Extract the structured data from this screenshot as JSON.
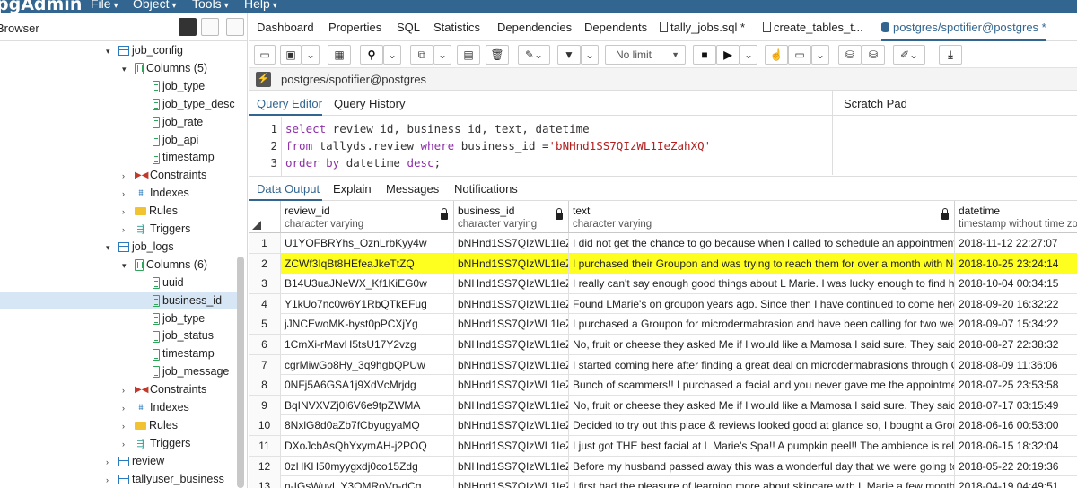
{
  "topbar": {
    "logo": "pgAdmin",
    "menus": [
      "File",
      "Object",
      "Tools",
      "Help"
    ]
  },
  "browser": {
    "title": "Browser",
    "tree": [
      {
        "label": "job_config",
        "icon": "table-icon",
        "toggle": "▾",
        "indent": 0
      },
      {
        "label": "Columns (5)",
        "icon": "columns-icon",
        "toggle": "▾",
        "indent": 1
      },
      {
        "label": "job_type",
        "icon": "column-icon",
        "toggle": "",
        "indent": 2
      },
      {
        "label": "job_type_desc",
        "icon": "column-icon",
        "toggle": "",
        "indent": 2
      },
      {
        "label": "job_rate",
        "icon": "column-icon",
        "toggle": "",
        "indent": 2
      },
      {
        "label": "job_api",
        "icon": "column-icon",
        "toggle": "",
        "indent": 2
      },
      {
        "label": "timestamp",
        "icon": "column-icon",
        "toggle": "",
        "indent": 2
      },
      {
        "label": "Constraints",
        "icon": "constraints-icon",
        "toggle": "›",
        "indent": 1
      },
      {
        "label": "Indexes",
        "icon": "indexes-icon",
        "toggle": "›",
        "indent": 1
      },
      {
        "label": "Rules",
        "icon": "rules-icon",
        "toggle": "›",
        "indent": 1
      },
      {
        "label": "Triggers",
        "icon": "triggers-icon",
        "toggle": "›",
        "indent": 1
      },
      {
        "label": "job_logs",
        "icon": "table-icon",
        "toggle": "▾",
        "indent": 0
      },
      {
        "label": "Columns (6)",
        "icon": "columns-icon",
        "toggle": "▾",
        "indent": 1
      },
      {
        "label": "uuid",
        "icon": "column-icon",
        "toggle": "",
        "indent": 2
      },
      {
        "label": "business_id",
        "icon": "column-icon",
        "toggle": "",
        "indent": 2,
        "selected": true
      },
      {
        "label": "job_type",
        "icon": "column-icon",
        "toggle": "",
        "indent": 2
      },
      {
        "label": "job_status",
        "icon": "column-icon",
        "toggle": "",
        "indent": 2
      },
      {
        "label": "timestamp",
        "icon": "column-icon",
        "toggle": "",
        "indent": 2
      },
      {
        "label": "job_message",
        "icon": "column-icon",
        "toggle": "",
        "indent": 2
      },
      {
        "label": "Constraints",
        "icon": "constraints-icon",
        "toggle": "›",
        "indent": 1
      },
      {
        "label": "Indexes",
        "icon": "indexes-icon",
        "toggle": "›",
        "indent": 1
      },
      {
        "label": "Rules",
        "icon": "rules-icon",
        "toggle": "›",
        "indent": 1
      },
      {
        "label": "Triggers",
        "icon": "triggers-icon",
        "toggle": "›",
        "indent": 1
      },
      {
        "label": "review",
        "icon": "table-icon",
        "toggle": "›",
        "indent": 0
      },
      {
        "label": "tallyuser_business",
        "icon": "table-icon",
        "toggle": "›",
        "indent": 0
      }
    ]
  },
  "tabs": [
    {
      "label": "Dashboard",
      "icon": ""
    },
    {
      "label": "Properties",
      "icon": ""
    },
    {
      "label": "SQL",
      "icon": ""
    },
    {
      "label": "Statistics",
      "icon": ""
    },
    {
      "label": "Dependencies",
      "icon": ""
    },
    {
      "label": "Dependents",
      "icon": ""
    },
    {
      "label": "tally_jobs.sql *",
      "icon": "file-icon"
    },
    {
      "label": "create_tables_t...",
      "icon": "file-icon"
    },
    {
      "label": "postgres/spotifier@postgres *",
      "icon": "database-icon",
      "active": true
    }
  ],
  "toolbar": {
    "limit_select": "No limit"
  },
  "connection": {
    "label": "postgres/spotifier@postgres"
  },
  "editor_tabs": {
    "query_editor": "Query Editor",
    "query_history": "Query History",
    "scratch_pad": "Scratch Pad"
  },
  "editor": {
    "lines": [
      {
        "num": "1",
        "parts": [
          {
            "t": "select",
            "c": "kw"
          },
          {
            "t": " review_id, business_id, text, datetime",
            "c": ""
          }
        ]
      },
      {
        "num": "2",
        "parts": [
          {
            "t": "from",
            "c": "kw"
          },
          {
            "t": " tallyds.review ",
            "c": ""
          },
          {
            "t": "where",
            "c": "kw"
          },
          {
            "t": " business_id =",
            "c": ""
          },
          {
            "t": "'bNHnd1SS7QIzWL1IeZahXQ'",
            "c": "str"
          }
        ]
      },
      {
        "num": "3",
        "parts": [
          {
            "t": "order by",
            "c": "kw"
          },
          {
            "t": " datetime ",
            "c": ""
          },
          {
            "t": "desc",
            "c": "kw"
          },
          {
            "t": ";",
            "c": ""
          }
        ]
      }
    ]
  },
  "output_tabs": {
    "data_output": "Data Output",
    "explain": "Explain",
    "messages": "Messages",
    "notifications": "Notifications"
  },
  "grid": {
    "columns": [
      {
        "name": "review_id",
        "type": "character varying"
      },
      {
        "name": "business_id",
        "type": "character varying"
      },
      {
        "name": "text",
        "type": "character varying"
      },
      {
        "name": "datetime",
        "type": "timestamp without time zone"
      }
    ],
    "rows": [
      {
        "n": "1",
        "cells": [
          "U1YOFBRYhs_OznLrbKyy4w",
          "bNHnd1SS7QIzWL1IeZ...",
          "I did not get the chance to go because when I called to schedule an appointment the ...",
          "2018-11-12 22:27:07"
        ]
      },
      {
        "n": "2",
        "cells": [
          "ZCWf3IqBt8HEfeaJkeTtZQ",
          "bNHnd1SS7QIzWL1IeZ...",
          "I purchased their Groupon and was trying to reach them for over a month with NO resp...",
          "2018-10-25 23:24:14"
        ],
        "highlight": true
      },
      {
        "n": "3",
        "cells": [
          "B14U3uaJNeWX_Kf1KiEG0w",
          "bNHnd1SS7QIzWL1IeZ...",
          "I really can't say enough good things about L Marie. I was lucky enough to find her bus...",
          "2018-10-04 00:34:15"
        ]
      },
      {
        "n": "4",
        "cells": [
          "Y1kUo7nc0w6Y1RbQTkEFug",
          "bNHnd1SS7QIzWL1IeZ...",
          "Found LMarie's on groupon years ago. Since then I have continued to come here. Mari...",
          "2018-09-20 16:32:22"
        ]
      },
      {
        "n": "5",
        "cells": [
          "jJNCEwoMK-hyst0pPCXjYg",
          "bNHnd1SS7QIzWL1IeZ...",
          "I purchased a Groupon for microdermabrasion and have been calling for two weeks to...",
          "2018-09-07 15:34:22"
        ]
      },
      {
        "n": "6",
        "cells": [
          "1CmXi-rMavH5tsU17Y2vzg",
          "bNHnd1SS7QIzWL1IeZ...",
          "No, fruit or cheese they asked Me if I would like a Mamosa I said sure. They said ok",
          "2018-08-27 22:38:32"
        ]
      },
      {
        "n": "7",
        "cells": [
          "cgrMiwGo8Hy_3q9hgbQPUw",
          "bNHnd1SS7QIzWL1IeZ...",
          "I started coming here after finding a great deal on microdermabrasions through Group...",
          "2018-08-09 11:36:06"
        ]
      },
      {
        "n": "8",
        "cells": [
          "0NFj5A6GSA1j9XdVcMrjdg",
          "bNHnd1SS7QIzWL1IeZ...",
          "Bunch of scammers!! I purchased a facial and you never gave me the appointment an...",
          "2018-07-25 23:53:58"
        ]
      },
      {
        "n": "9",
        "cells": [
          "BqINVXVZj0l6V6e9tpZWMA",
          "bNHnd1SS7QIzWL1IeZ...",
          "No, fruit or cheese they asked Me if I would like a Mamosa I said sure. They said ok",
          "2018-07-17 03:15:49"
        ]
      },
      {
        "n": "10",
        "cells": [
          "8NxlG8d0aZb7fCbyugyaMQ",
          "bNHnd1SS7QIzWL1IeZ...",
          "Decided to try out this place & reviews looked good at glance so, I bought a Groupon f...",
          "2018-06-16 00:53:00"
        ]
      },
      {
        "n": "11",
        "cells": [
          "DXoJcbAsQhYxymAH-j2POQ",
          "bNHnd1SS7QIzWL1IeZ...",
          "I just got THE best facial at L Marie's Spa!! A pumpkin peel!! The ambience is relaxing, ...",
          "2018-06-15 18:32:04"
        ]
      },
      {
        "n": "12",
        "cells": [
          "0zHKH50myygxdj0co15Zdg",
          "bNHnd1SS7QIzWL1IeZ...",
          "Before my husband passed away this was a wonderful day that we were going to spen...",
          "2018-05-22 20:19:36"
        ]
      },
      {
        "n": "13",
        "cells": [
          "n-IGsWuyl_Y3QMRoVn-dCg",
          "bNHnd1SS7QIzWL1IeZ...",
          "I first had the pleasure of learning more about skincare with L Marie a few months bac...",
          "2018-04-19 04:49:51"
        ]
      }
    ]
  },
  "colors": {
    "brand": "#326690",
    "highlight": "#ffff1f",
    "keyword": "#8e2fa8",
    "string": "#b21f1f"
  }
}
